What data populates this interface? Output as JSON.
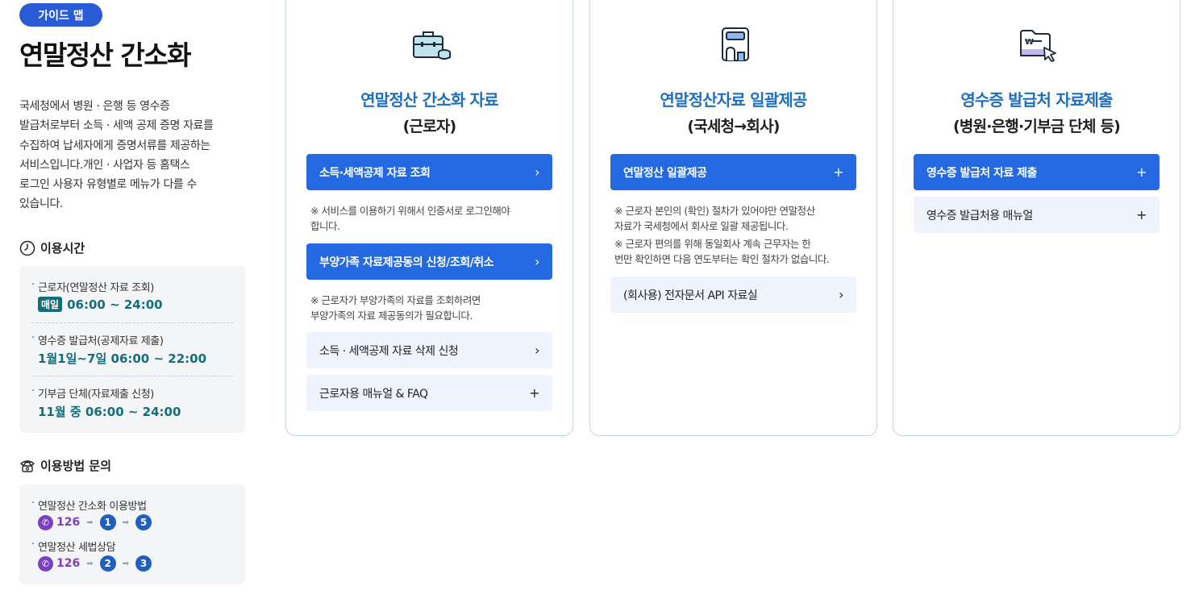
{
  "sidebar": {
    "badge": "가이드 맵",
    "title": "연말정산 간소화",
    "intro_lines": [
      "국세청에서 병원 · 은행 등 영수증",
      "발급처로부터 소득 · 세액 공제 증명 자료를",
      "수집하여 납세자에게 증명서류를 제공하는",
      "서비스입니다.개인 · 사업자 등 홈택스",
      "로그인 사용자 유형별로 메뉴가 다를 수",
      "있습니다."
    ],
    "time_heading": "이용시간",
    "time_items": [
      {
        "label": "근로자(연말정산 자료 조회)",
        "badge": "매일",
        "value": "06:00 ~ 24:00"
      },
      {
        "label": "영수증 발급처(공제자료 제출)",
        "value": "1월1일~7일 06:00 ~ 22:00"
      },
      {
        "label": "기부금 단체(자료제출 신청)",
        "value": "11월 중 06:00 ~ 24:00"
      }
    ],
    "inquiry_heading": "이용방법 문의",
    "inquiry_items": [
      {
        "label": "연말정산 간소화 이용방법",
        "phone": "126",
        "steps": [
          "1",
          "5"
        ]
      },
      {
        "label": "연말정산 세법상담",
        "phone": "126",
        "steps": [
          "2",
          "3"
        ]
      }
    ]
  },
  "cards": [
    {
      "title": "연말정산 간소화 자료",
      "subtitle": "(근로자)",
      "icon": "briefcase-coins-icon",
      "buttons": [
        {
          "label": "소득·세액공제 자료 조회",
          "style": "primary",
          "trail": "›"
        },
        {
          "label": "부양가족 자료제공동의 신청/조회/취소",
          "style": "primary",
          "trail": "›"
        },
        {
          "label": "소득 · 세액공제 자료 삭제 신청",
          "style": "light",
          "trail": "›"
        },
        {
          "label": "근로자용 매뉴얼 & FAQ",
          "style": "light",
          "trail": "+"
        }
      ],
      "notes": [
        [
          "※ 서비스를 이용하기 위해서 인증서로 로그인해야",
          "합니다."
        ],
        [
          "※ 근로자가 부양가족의 자료를 조회하려면",
          "부양가족의 자료 제공동의가 필요합니다."
        ]
      ]
    },
    {
      "title": "연말정산자료 일괄제공",
      "subtitle": "(국세청→회사)",
      "icon": "building-icon",
      "buttons": [
        {
          "label": "연말정산 일괄제공",
          "style": "primary",
          "trail": "+"
        },
        {
          "label": "(회사용) 전자문서 API 자료실",
          "style": "light",
          "trail": "›"
        }
      ],
      "notes": [
        [
          "※ 근로자 본인의 (확인) 절차가 있어야만 연말정산",
          "자료가 국세청에서 회사로 일괄 제공됩니다."
        ],
        [
          "※ 근로자 편의를 위해 동일회사 계속 근무자는 한",
          "번만 확인하면 다음 연도부터는 확인 절차가 없습니다."
        ]
      ]
    },
    {
      "title": "영수증 발급처 자료제출",
      "subtitle": "(병원·은행·기부금 단체 등)",
      "icon": "folder-won-cursor-icon",
      "buttons": [
        {
          "label": "영수증 발급처 자료 제출",
          "style": "primary",
          "trail": "+"
        },
        {
          "label": "영수증 발급처용 매뉴얼",
          "style": "light",
          "trail": "+"
        }
      ]
    }
  ],
  "colors": {
    "primary": "#2569e2",
    "light_button": "#eef3fd",
    "title_blue": "#1e6fc0",
    "time_teal": "#146e7a",
    "phone_purple": "#7b3fc6"
  }
}
